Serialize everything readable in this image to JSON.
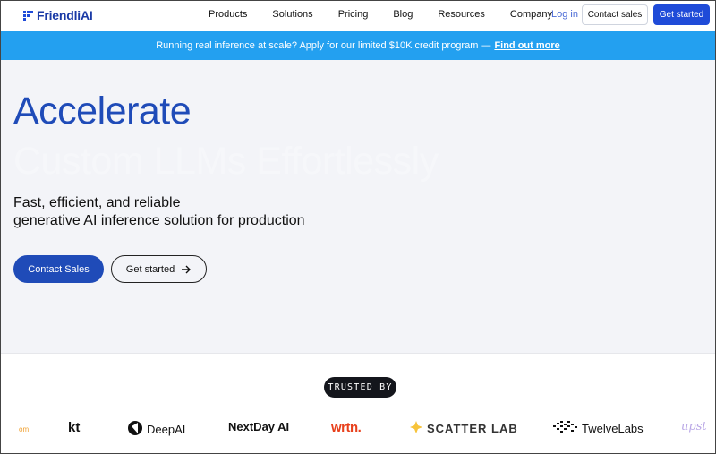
{
  "nav": {
    "logo": "FriendliAI",
    "links": [
      "Products",
      "Solutions",
      "Pricing",
      "Blog",
      "Resources",
      "Company"
    ],
    "login": "Log in",
    "contact_sales": "Contact sales",
    "get_started": "Get started"
  },
  "banner": {
    "text": "Running real inference at scale? Apply for our limited $10K credit program —",
    "link": "Find out more"
  },
  "hero": {
    "title_line1": "Accelerate",
    "title_line2": "Custom LLMs Effortlessly",
    "subtitle_line1": "Fast, efficient, and reliable",
    "subtitle_line2": "generative AI inference solution for production",
    "contact_sales": "Contact Sales",
    "get_started": "Get started"
  },
  "trusted": {
    "label": "TRUSTED BY",
    "brands": [
      "om",
      "kt",
      "DeepAI",
      "NextDay AI",
      "wrtn.",
      "SCATTER LAB",
      "TwelveLabs",
      "upst"
    ]
  },
  "colors": {
    "accent": "#1f4bd8",
    "banner": "#23a0f0",
    "hero_bg": "#f3f4f8",
    "wrtn": "#e8401c",
    "scatter_icon": "#f7c33a"
  }
}
